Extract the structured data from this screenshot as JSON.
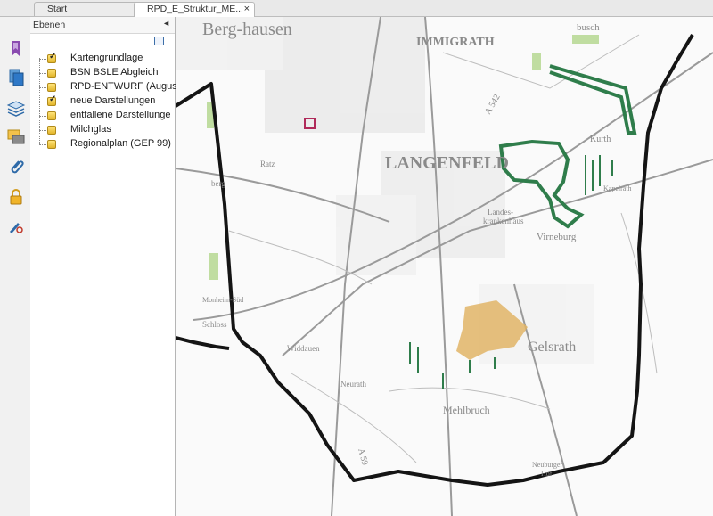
{
  "tabs": [
    {
      "label": "Start"
    },
    {
      "label": "RPD_E_Struktur_ME...",
      "close": "×"
    }
  ],
  "panel": {
    "title": "Ebenen",
    "collapse": "◄",
    "layers": [
      {
        "label": "Kartengrundlage",
        "checked": true
      },
      {
        "label": "BSN BSLE Abgleich",
        "checked": false
      },
      {
        "label": "RPD-ENTWURF (August",
        "checked": false
      },
      {
        "label": "neue Darstellungen",
        "checked": true
      },
      {
        "label": "entfallene Darstellunge",
        "checked": false
      },
      {
        "label": "Milchglas",
        "checked": false
      },
      {
        "label": "Regionalplan (GEP 99)",
        "checked": false
      }
    ]
  },
  "toolbar": {
    "icons": [
      "bookmark-icon",
      "pages-icon",
      "layers-icon",
      "comments-icon",
      "attachment-icon",
      "lock-icon",
      "signature-icon"
    ]
  },
  "map": {
    "labels": {
      "berg_hausen": "Berg-hausen",
      "hausen": "hausen",
      "immigrath": "IMMIGRATH",
      "busch": "busch",
      "langenfeld": "LANGENFELD",
      "landes": "Landes-",
      "krankenhaus": "krankenhaus",
      "virneburg": "Virneburg",
      "monheim_sud": "Monheim-Süd",
      "schloss": "Schloss",
      "widdauen": "Widdauen",
      "neurath": "Neurath",
      "mehlbruch": "Mehlbruch",
      "neuburger": "Neuburger",
      "hof": "Hof",
      "a59": "A 59",
      "a542": "A 542",
      "kurth": "Kurth",
      "gelsrath": "Gelsrath",
      "kapelrath": "Kapelrath",
      "ratz": "Ratz",
      "berg": "berg"
    },
    "colors": {
      "boundary": "#141414",
      "green_outline": "#2f7d4b",
      "orange_area": "#e1b466",
      "magenta_marker": "#b02a5a",
      "light_green": "#a7d07a"
    }
  }
}
